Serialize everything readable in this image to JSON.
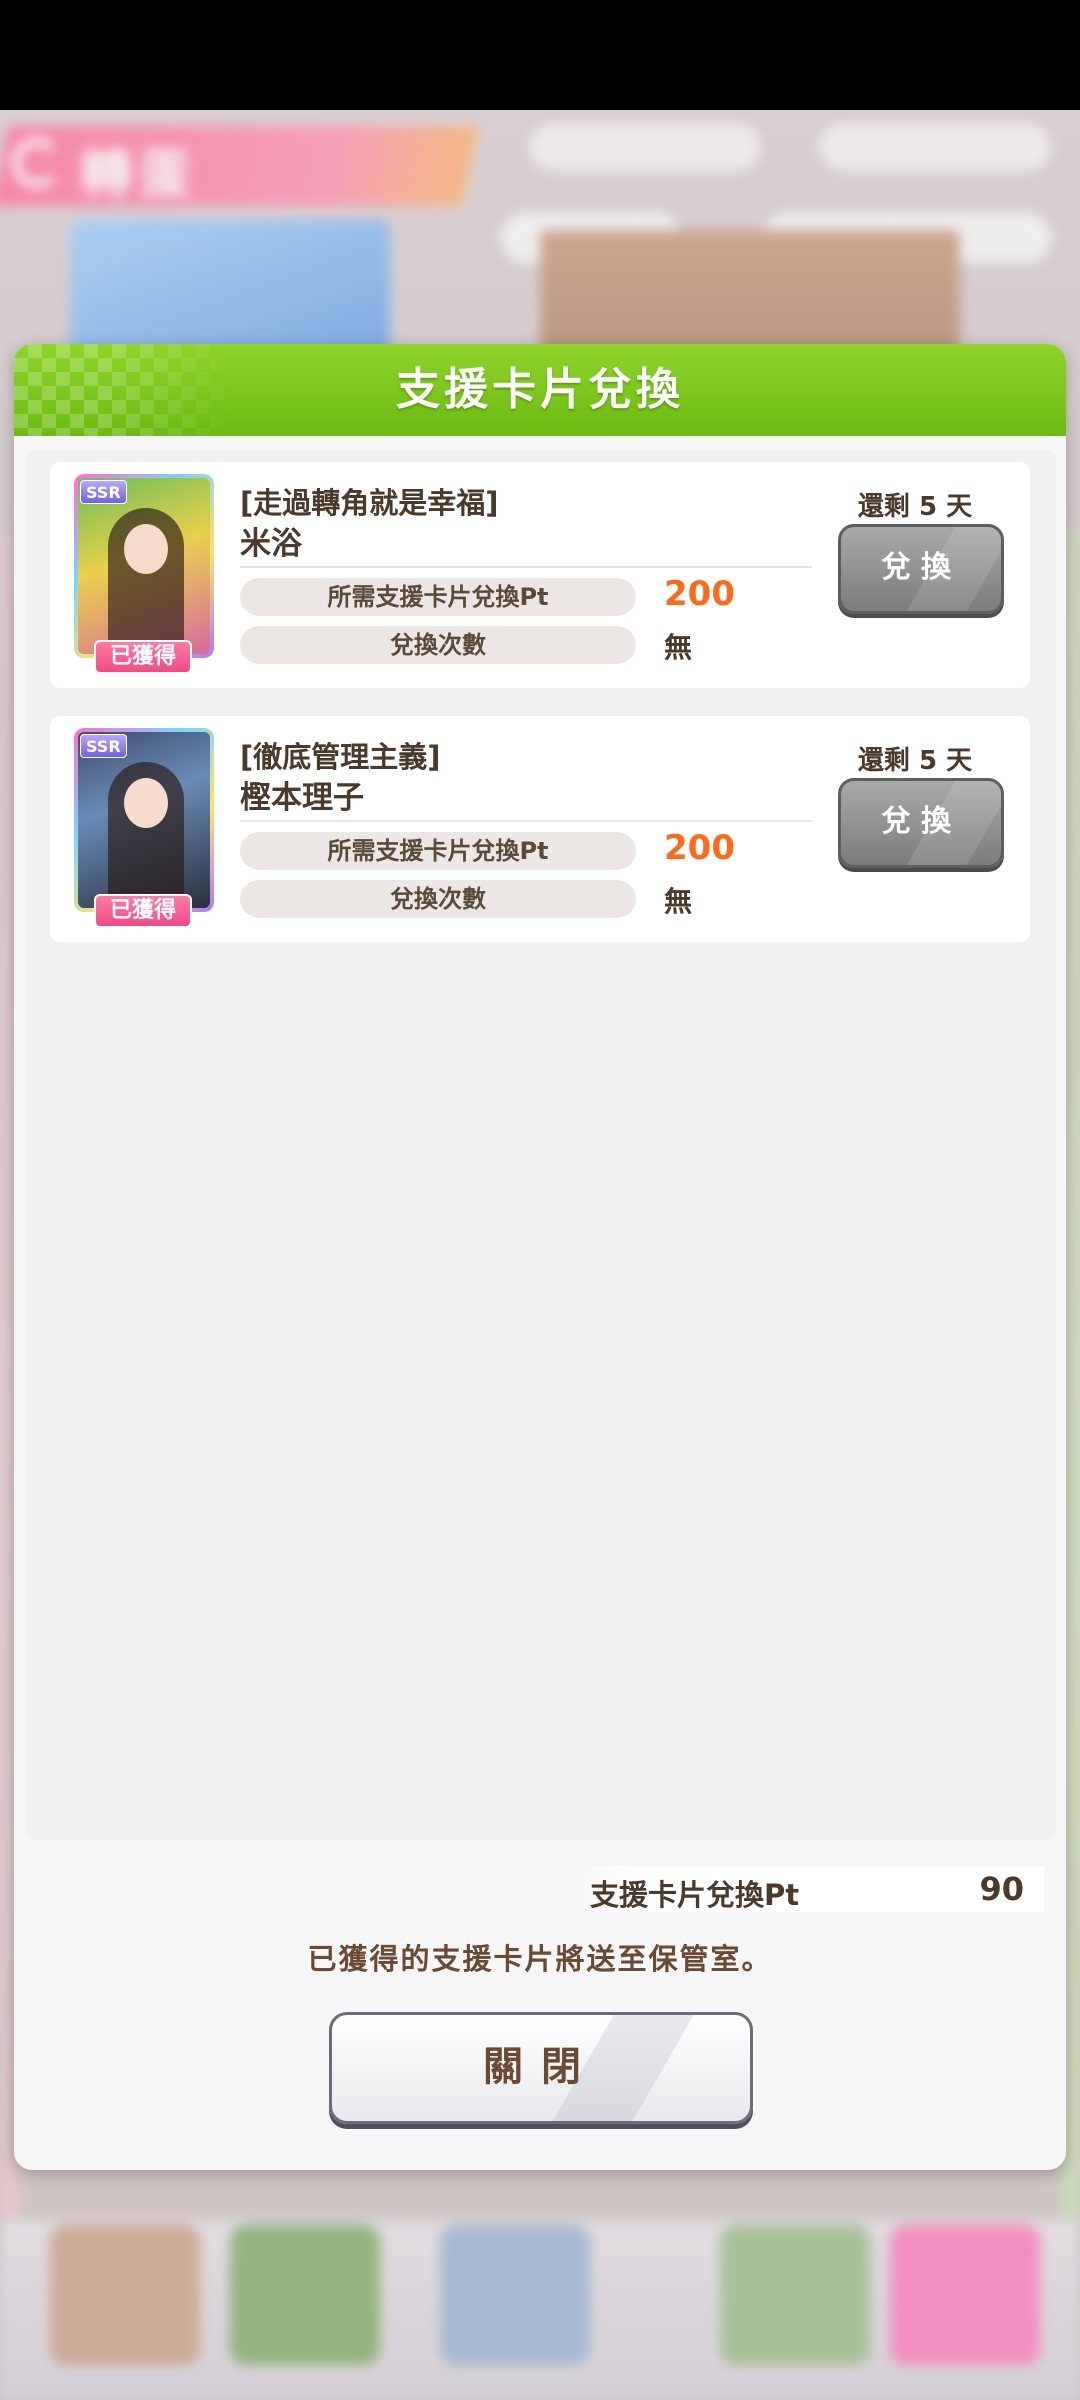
{
  "background": {
    "header_title": "轉蛋"
  },
  "modal": {
    "title": "支援卡片兌換",
    "cards": [
      {
        "rarity": "SSR",
        "subtitle": "[走過轉角就是幸福]",
        "name": "米浴",
        "obtained_badge": "已獲得",
        "cost_label": "所需支援卡片兌換Pt",
        "cost_value": "200",
        "count_label": "兌換次數",
        "count_value": "無",
        "remaining": "還剩 5 天",
        "exchange_label": "兌換"
      },
      {
        "rarity": "SSR",
        "subtitle": "[徹底管理主義]",
        "name": "樫本理子",
        "obtained_badge": "已獲得",
        "cost_label": "所需支援卡片兌換Pt",
        "cost_value": "200",
        "count_label": "兌換次數",
        "count_value": "無",
        "remaining": "還剩 5 天",
        "exchange_label": "兌換"
      }
    ],
    "points_label": "支援卡片兌換Pt",
    "points_value": "90",
    "notice": "已獲得的支援卡片將送至保管室。",
    "close_label": "關閉"
  },
  "colors": {
    "header_green": "#7cc81c",
    "cost_orange": "#ff6a1a",
    "text_brown": "#4a3a2a",
    "badge_pink": "#f04b82"
  }
}
